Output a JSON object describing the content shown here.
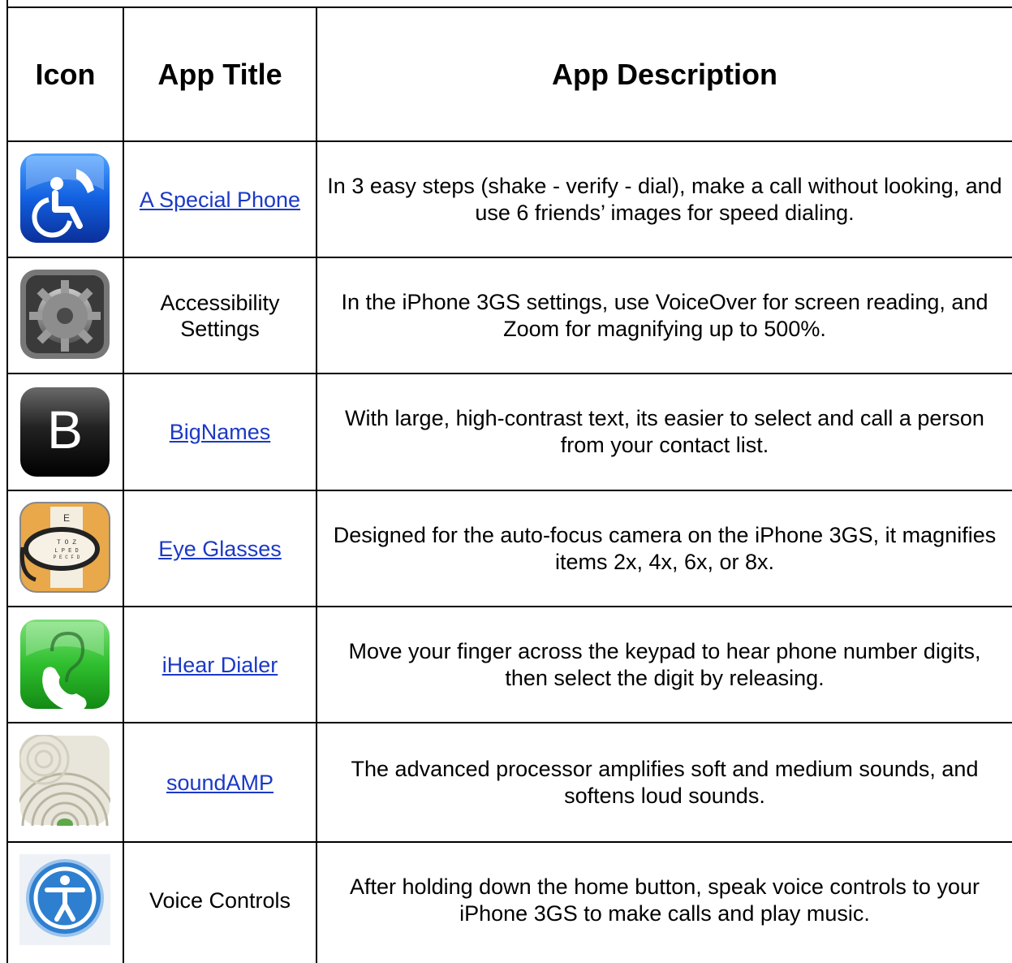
{
  "table": {
    "headers": {
      "icon": "Icon",
      "title": "App Title",
      "description": "App Description"
    },
    "rows": [
      {
        "icon": "wheelchair-phone-icon",
        "title": "A Special Phone",
        "title_is_link": true,
        "description": "In 3 easy steps (shake - verify - dial), make a call without looking, and use 6 friends’ images for speed dialing."
      },
      {
        "icon": "settings-gear-icon",
        "title": "Accessibility Settings",
        "title_is_link": false,
        "description": "In the iPhone 3GS settings, use VoiceOver for screen reading, and Zoom for magnifying up to 500%."
      },
      {
        "icon": "letter-b-icon",
        "title": "BigNames",
        "title_is_link": true,
        "description": "With large, high-contrast text, its easier to select and call a person from your contact list."
      },
      {
        "icon": "eye-glasses-icon",
        "title": "Eye Glasses",
        "title_is_link": true,
        "description": "Designed for the auto-focus camera on the iPhone 3GS, it magnifies items 2x, 4x, 6x, or 8x."
      },
      {
        "icon": "ear-phone-icon",
        "title": "iHear Dialer",
        "title_is_link": true,
        "description": "Move your finger across the keypad to hear phone number digits, then select the digit by releasing."
      },
      {
        "icon": "sound-waves-icon",
        "title": "soundAMP",
        "title_is_link": true,
        "description": "The advanced processor amplifies soft and medium sounds, and softens loud sounds."
      },
      {
        "icon": "accessibility-person-icon",
        "title": "Voice Controls",
        "title_is_link": false,
        "description": "After holding down the home button, speak voice controls to your iPhone 3GS to make calls and play music."
      }
    ]
  },
  "colors": {
    "link": "#1b39c6",
    "border": "#000000"
  }
}
